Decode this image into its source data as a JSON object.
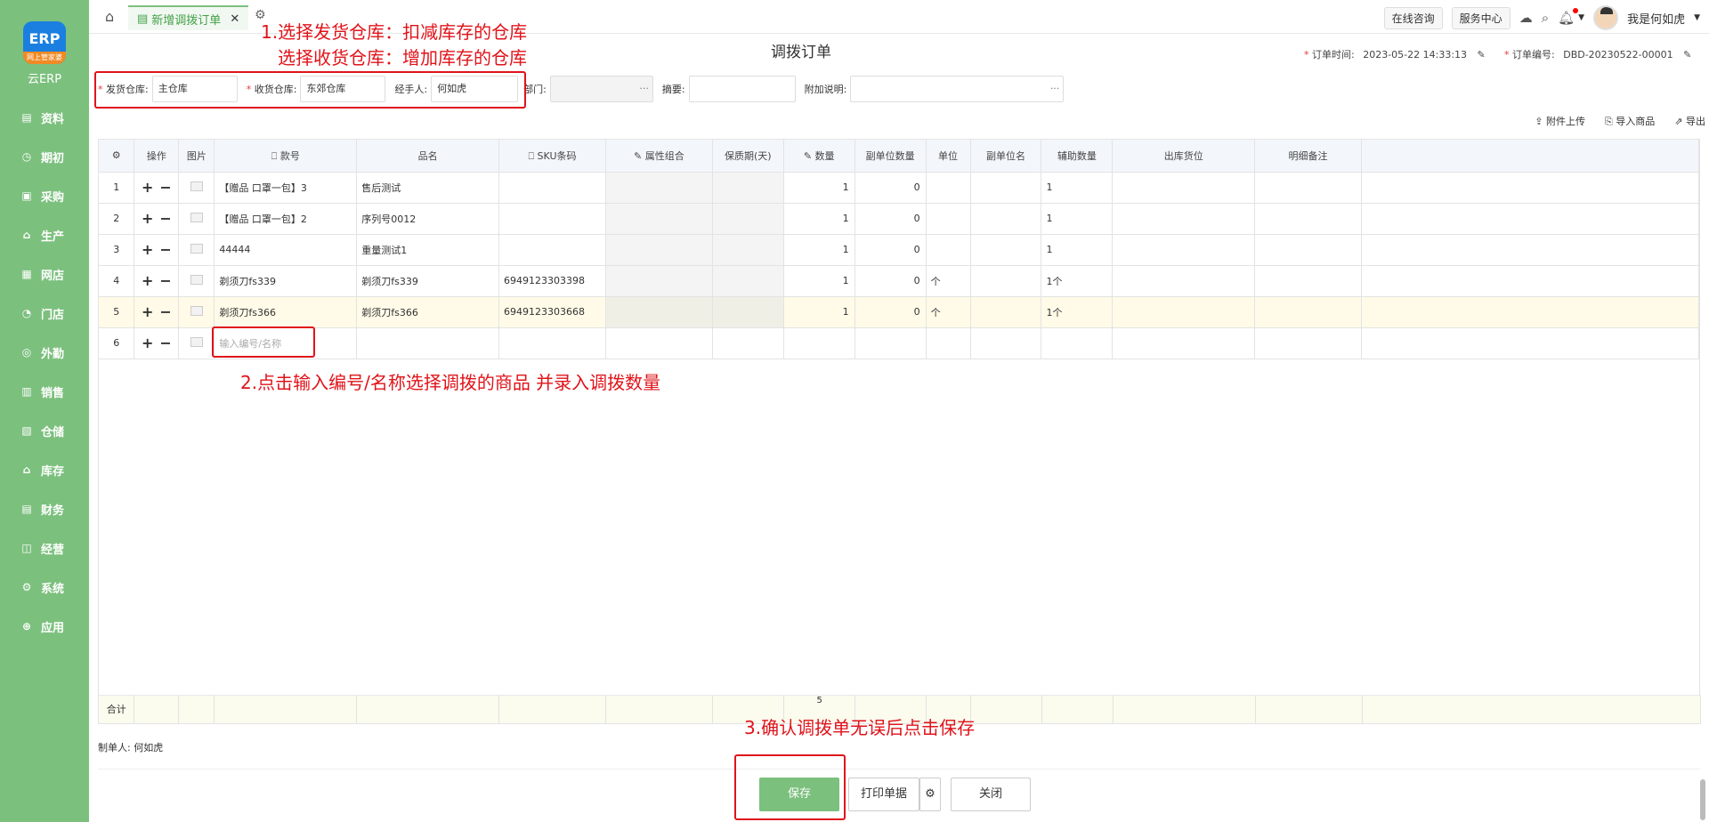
{
  "app": {
    "logo_text": "ERP",
    "logo_sub": "网上管家婆",
    "brand": "云ERP"
  },
  "sidebar": {
    "items": [
      {
        "label": "资料",
        "icon": "book-icon"
      },
      {
        "label": "期初",
        "icon": "clock-icon"
      },
      {
        "label": "采购",
        "icon": "cart-icon"
      },
      {
        "label": "生产",
        "icon": "factory-icon"
      },
      {
        "label": "网店",
        "icon": "shop-icon"
      },
      {
        "label": "门店",
        "icon": "pie-icon"
      },
      {
        "label": "外勤",
        "icon": "target-icon"
      },
      {
        "label": "销售",
        "icon": "chart-icon"
      },
      {
        "label": "仓储",
        "icon": "warehouse-icon"
      },
      {
        "label": "库存",
        "icon": "home-icon"
      },
      {
        "label": "财务",
        "icon": "money-icon"
      },
      {
        "label": "经营",
        "icon": "business-icon"
      },
      {
        "label": "系统",
        "icon": "gear-icon"
      },
      {
        "label": "应用",
        "icon": "plus-icon"
      }
    ]
  },
  "topbar": {
    "tab_label": "新增调拨订单",
    "online_consult": "在线咨询",
    "service_center": "服务中心",
    "user_name": "我是何如虎"
  },
  "page": {
    "title": "调拨订单",
    "order_time_label": "订单时间:",
    "order_time": "2023-05-22 14:33:13",
    "order_no_label": "订单编号:",
    "order_no": "DBD-20230522-00001"
  },
  "form": {
    "send_wh_label": "发货仓库:",
    "send_wh": "主仓库",
    "recv_wh_label": "收货仓库:",
    "recv_wh": "东郊仓库",
    "handler_label": "经手人:",
    "handler": "何如虎",
    "dept_label": "部门:",
    "summary_label": "摘要:",
    "note_label": "附加说明:"
  },
  "annotations": {
    "a1_line1": "1.选择发货仓库：扣减库存的仓库",
    "a1_line2": "选择收货仓库：增加库存的仓库",
    "a2": "2.点击输入编号/名称选择调拨的商品 并录入调拨数量",
    "a3": "3.确认调拨单无误后点击保存"
  },
  "actions": {
    "upload": "附件上传",
    "import": "导入商品",
    "export": "导出"
  },
  "table": {
    "headers": [
      "操作",
      "图片",
      "款号",
      "品名",
      "SKU条码",
      "属性组合",
      "保质期(天)",
      "数量",
      "副单位数量",
      "单位",
      "副单位名",
      "辅助数量",
      "出库货位",
      "明细备注"
    ],
    "rows": [
      {
        "no": "1",
        "code": "【赠品  口罩一包】3",
        "name": "售后测试",
        "sku": "",
        "qty": "1",
        "subqty": "0",
        "unit": "",
        "aux": "1"
      },
      {
        "no": "2",
        "code": "【赠品  口罩一包】2",
        "name": "序列号0012",
        "sku": "",
        "qty": "1",
        "subqty": "0",
        "unit": "",
        "aux": "1"
      },
      {
        "no": "3",
        "code": "44444",
        "name": "重量测试1",
        "sku": "",
        "qty": "1",
        "subqty": "0",
        "unit": "",
        "aux": "1"
      },
      {
        "no": "4",
        "code": "剃须刀fs339",
        "name": "剃须刀fs339",
        "sku": "6949123303398",
        "qty": "1",
        "subqty": "0",
        "unit": "个",
        "aux": "1个"
      },
      {
        "no": "5",
        "code": "剃须刀fs366",
        "name": "剃须刀fs366",
        "sku": "6949123303668",
        "qty": "1",
        "subqty": "0",
        "unit": "个",
        "aux": "1个"
      }
    ],
    "new_row_no": "6",
    "input_placeholder": "输入编号/名称",
    "total_label": "合计",
    "total_qty": "5"
  },
  "footer": {
    "maker_label": "制单人:",
    "maker": "何如虎",
    "save": "保存",
    "print": "打印单据",
    "close": "关闭"
  }
}
